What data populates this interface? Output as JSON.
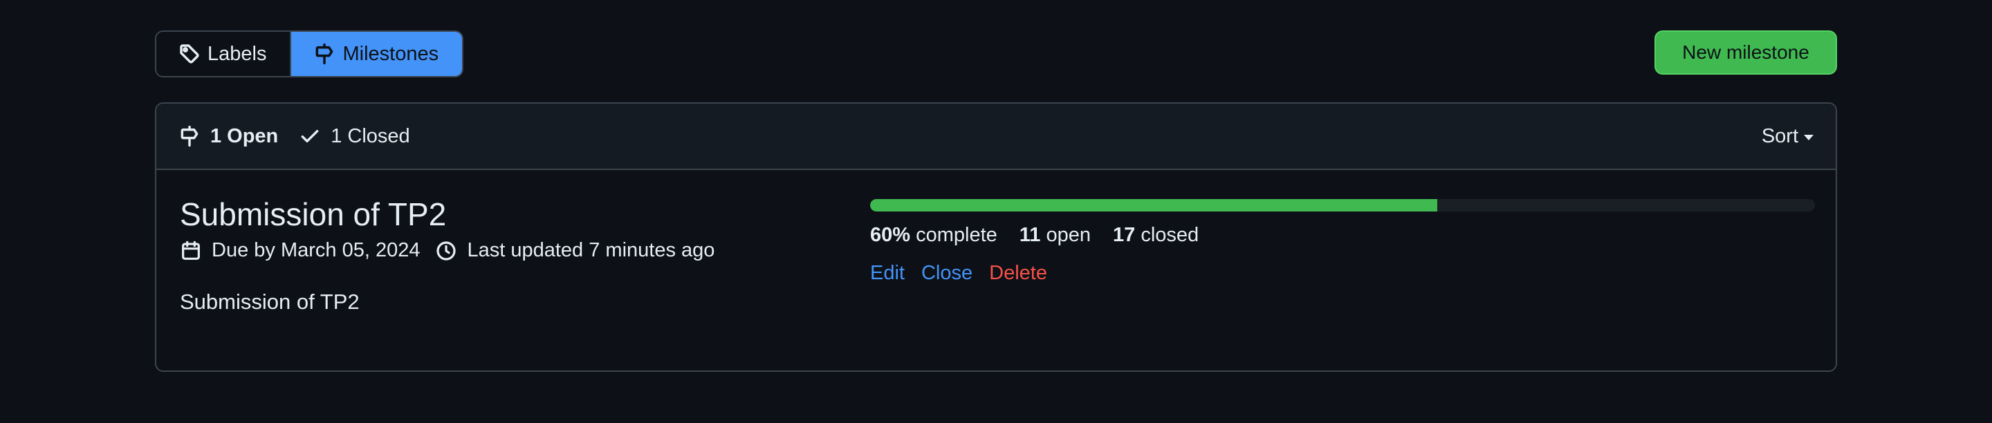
{
  "subnav": {
    "labels_label": "Labels",
    "milestones_label": "Milestones",
    "selected": "milestones"
  },
  "new_milestone_label": "New milestone",
  "box_header": {
    "open_count": "1",
    "open_label": "Open",
    "closed_count": "1",
    "closed_label": "Closed",
    "sort_label": "Sort"
  },
  "milestones": [
    {
      "title": "Submission of TP2",
      "due": "Due by March 05, 2024",
      "updated": "Last updated 7 minutes ago",
      "description": "Submission of TP2",
      "progress_percent": 60,
      "percent_label": "60%",
      "complete_label": "complete",
      "open_count": "11",
      "open_label": "open",
      "closed_count": "17",
      "closed_label": "closed",
      "actions": {
        "edit": "Edit",
        "close": "Close",
        "delete": "Delete"
      }
    }
  ],
  "colors": {
    "background": "#0d1117",
    "accent_blue": "#4493f8",
    "success_green": "#3fb950",
    "danger_red": "#f85149",
    "border": "#3d444d"
  },
  "icons": {
    "labels": "tag-icon",
    "milestones": "milestone-icon",
    "open": "milestone-icon",
    "closed": "check-icon",
    "due": "calendar-icon",
    "updated": "clock-icon"
  }
}
